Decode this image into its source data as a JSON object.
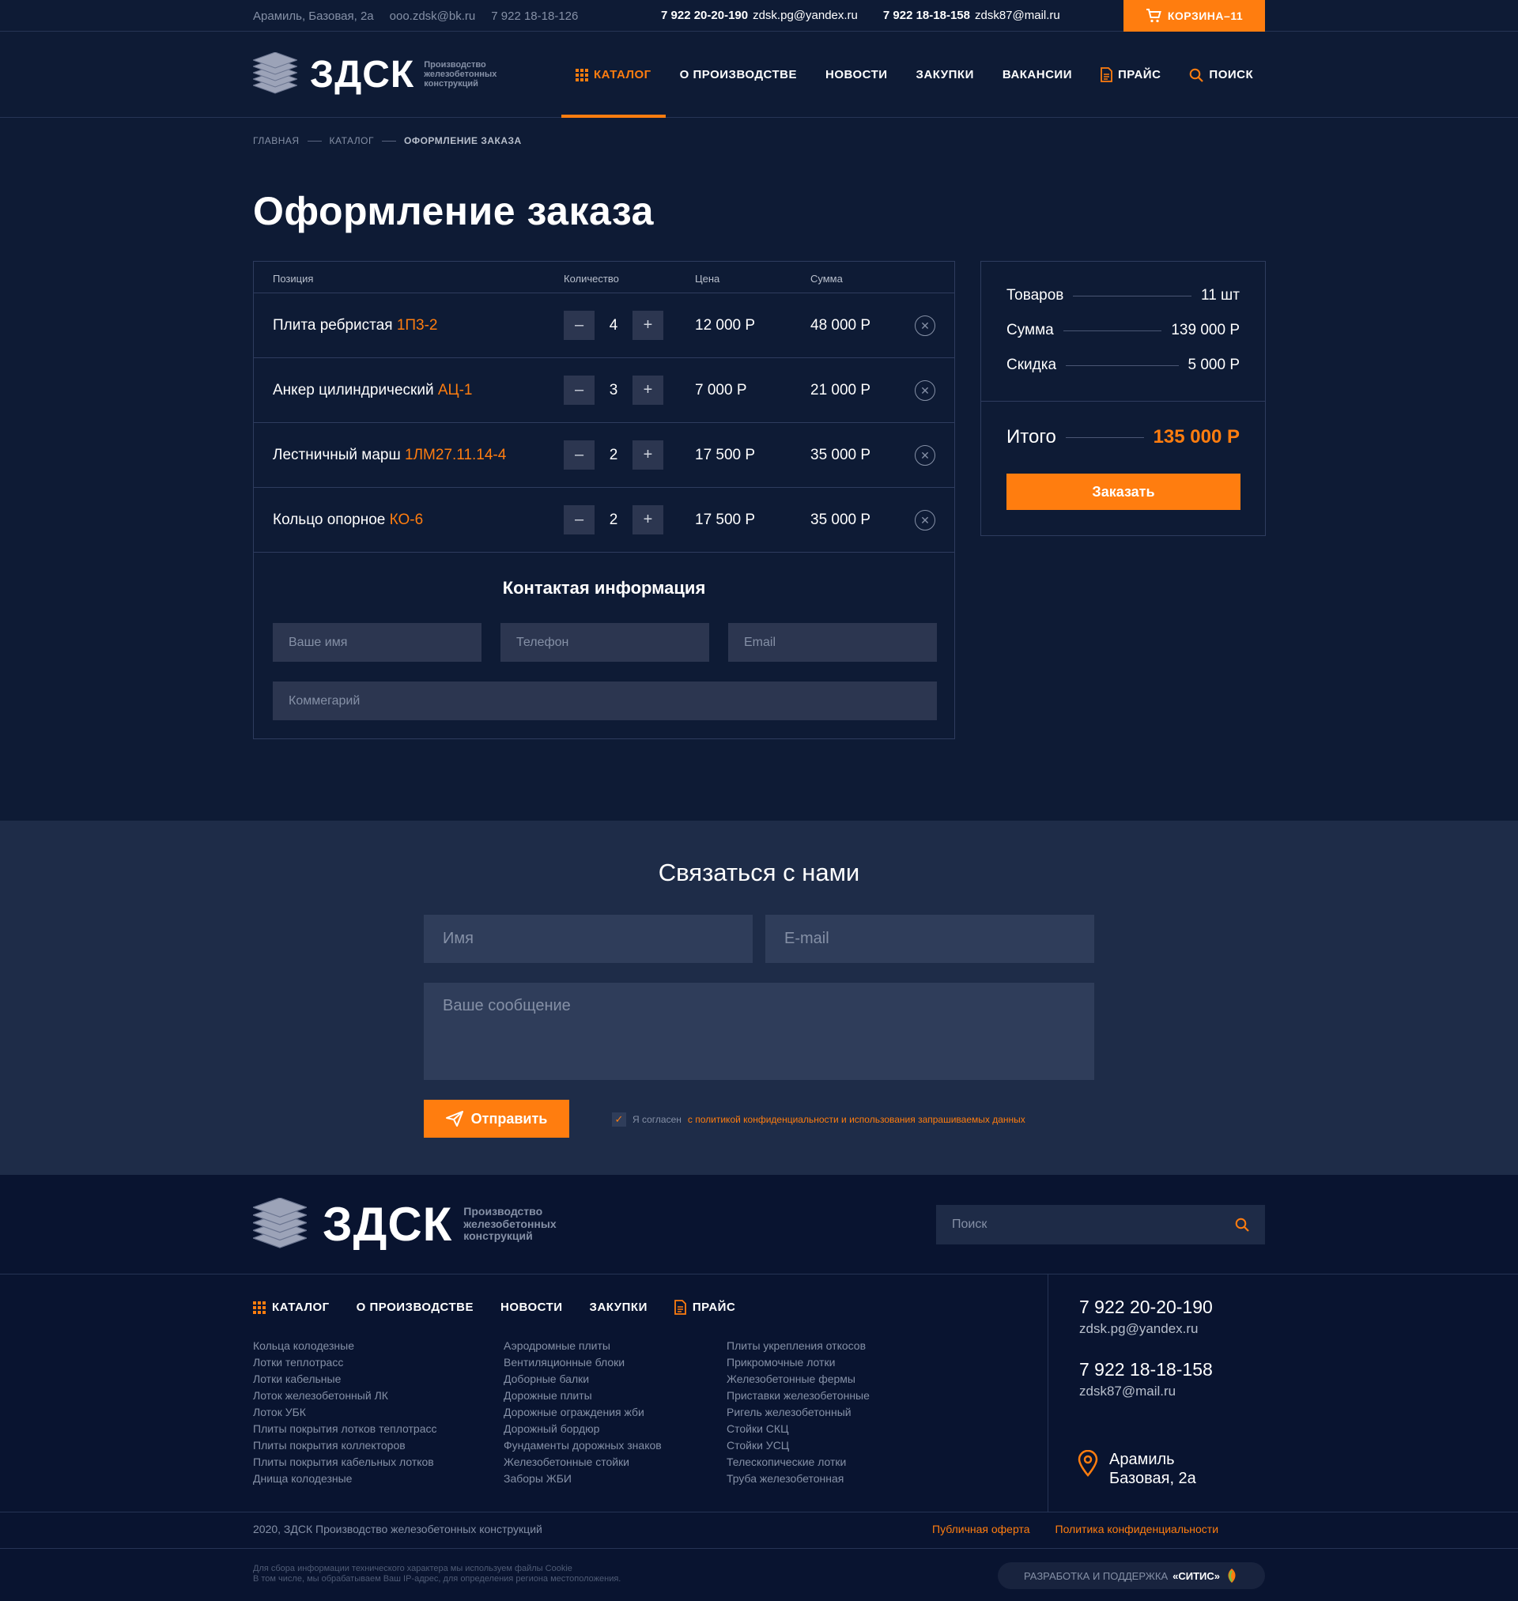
{
  "topbar": {
    "address": "Арамиль, Базовая, 2а",
    "email": "ooo.zdsk@bk.ru",
    "phone_small": "7 922 18-18-126",
    "phone1": "7 922 20-20-190",
    "email1": "zdsk.pg@yandex.ru",
    "phone2": "7 922 18-18-158",
    "email2": "zdsk87@mail.ru",
    "cart_label": "КОРЗИНА",
    "cart_count": "–11"
  },
  "logo": {
    "word": "ЗДСК",
    "tagline1": "Производство",
    "tagline2": "железобетонных",
    "tagline3": "конструкций"
  },
  "nav": {
    "catalog": "КАТАЛОГ",
    "production": "О ПРОИЗВОДСТВЕ",
    "news": "НОВОСТИ",
    "purchases": "ЗАКУПКИ",
    "vacancies": "ВАКАНСИИ",
    "price": "ПРАЙС",
    "search": "ПОИСК"
  },
  "breadcrumb": {
    "home": "ГЛАВНАЯ",
    "catalog": "КАТАЛОГ",
    "current": "ОФОРМЛЕНИЕ ЗАКАЗА"
  },
  "page_title": "Оформление заказа",
  "table": {
    "headers": {
      "position": "Позиция",
      "qty": "Количество",
      "price": "Цена",
      "sum": "Сумма"
    },
    "rows": [
      {
        "name": "Плита ребристая",
        "code": "1П3-2",
        "qty": "4",
        "price": "12 000 Р",
        "sum": "48 000 Р"
      },
      {
        "name": "Анкер цилиндрический",
        "code": "АЦ-1",
        "qty": "3",
        "price": "7 000 Р",
        "sum": "21 000 Р"
      },
      {
        "name": "Лестничный марш",
        "code": "1ЛМ27.11.14-4",
        "qty": "2",
        "price": "17 500 Р",
        "sum": "35 000 Р"
      },
      {
        "name": "Кольцо опорное",
        "code": "КО-6",
        "qty": "2",
        "price": "17 500 Р",
        "sum": "35 000 Р"
      }
    ],
    "minus": "–",
    "plus": "+",
    "remove": "✕"
  },
  "contact_info": {
    "title": "Контактая информация",
    "name_placeholder": "Ваше имя",
    "phone_placeholder": "Телефон",
    "email_placeholder": "Email",
    "comment_placeholder": "Коммегарий"
  },
  "summary": {
    "items_label": "Товаров",
    "items_value": "11 шт",
    "sum_label": "Сумма",
    "sum_value": "139 000 Р",
    "discount_label": "Скидка",
    "discount_value": "5 000 Р",
    "total_label": "Итого",
    "total_value": "135 000 Р",
    "order_button": "Заказать"
  },
  "contact_form": {
    "title": "Связаться с нами",
    "name_placeholder": "Имя",
    "email_placeholder": "E-mail",
    "message_placeholder": "Ваше сообщение",
    "send_button": "Отправить",
    "agree_text": "Я согласен",
    "agree_link": "с политикой конфиденциальности и использования запрашиваемых данных"
  },
  "footer": {
    "search_placeholder": "Поиск",
    "nav": {
      "catalog": "КАТАЛОГ",
      "production": "О ПРОИЗВОДСТВЕ",
      "news": "НОВОСТИ",
      "purchases": "ЗАКУПКИ",
      "price": "ПРАЙС"
    },
    "col1": [
      "Кольца колодезные",
      "Лотки теплотрасс",
      "Лотки кабельные",
      "Лоток железобетонный ЛК",
      "Лоток УБК",
      "Плиты покрытия лотков теплотрасс",
      "Плиты покрытия коллекторов",
      "Плиты покрытия кабельных лотков",
      "Днища колодезные"
    ],
    "col2": [
      "Аэродромные плиты",
      "Вентиляционные блоки",
      "Доборные балки",
      "Дорожные плиты",
      "Дорожные ограждения жби",
      "Дорожный бордюр",
      "Фундаменты дорожных знаков",
      "Железобетонные стойки",
      "Заборы ЖБИ"
    ],
    "col3": [
      "Плиты укрепления откосов",
      "Прикромочные лотки",
      "Железобетонные фермы",
      "Приставки железобетонные",
      "Ригель железобетонный",
      "Стойки СКЦ",
      "Стойки УСЦ",
      "Телескопические лотки",
      "Труба железобетонная"
    ],
    "phone1": "7 922 20-20-190",
    "email1": "zdsk.pg@yandex.ru",
    "phone2": "7 922 18-18-158",
    "email2": "zdsk87@mail.ru",
    "address1": "Арамиль",
    "address2": "Базовая, 2а",
    "copyright": "2020, ЗДСК Производство железобетонных конструкций",
    "offer": "Публичная оферта",
    "privacy": "Политика конфиденциальности",
    "cookie1": "Для сбора информации технического характера мы используем файлы Cookie",
    "cookie2": "В том числе, мы обрабатываем Ваш IP-адрес, для определения региона местоположения.",
    "dev_label": "РАЗРАБОТКА И ПОДДЕРЖКА",
    "dev_name": "«СИТИС»"
  }
}
